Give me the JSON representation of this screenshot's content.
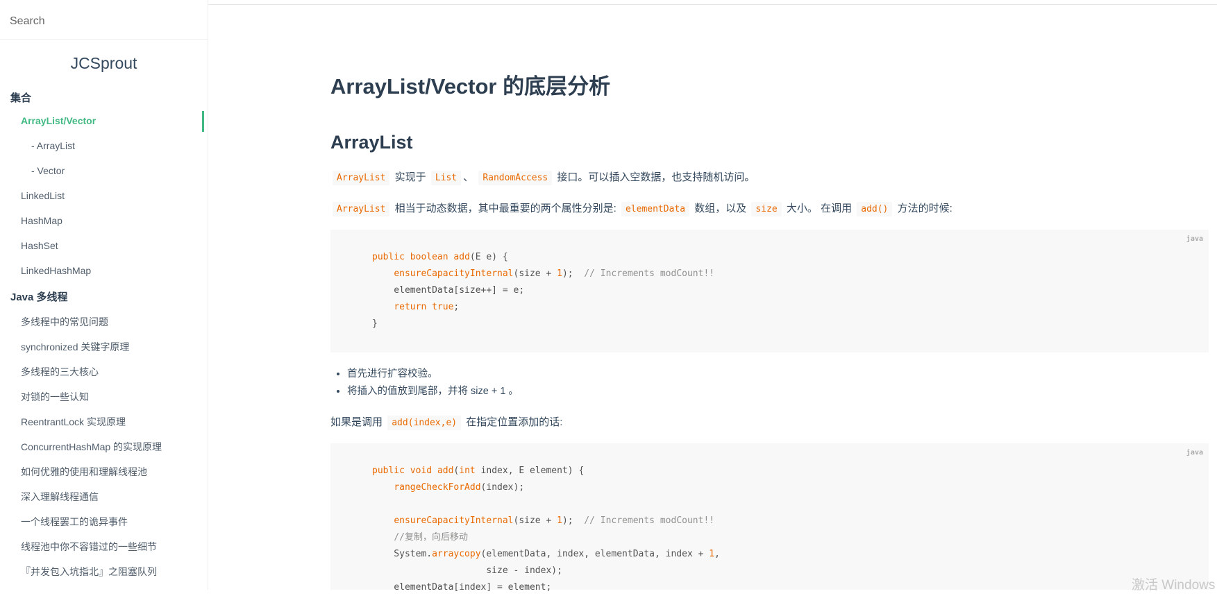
{
  "search": {
    "placeholder": "Search"
  },
  "app_name": "JCSprout",
  "sidebar": {
    "sections": [
      {
        "title": "集合"
      },
      {
        "title": "Java 多线程"
      }
    ],
    "items": [
      {
        "label": "ArrayList/Vector",
        "active": true
      },
      {
        "label": "- ArrayList"
      },
      {
        "label": "- Vector"
      },
      {
        "label": "LinkedList"
      },
      {
        "label": "HashMap"
      },
      {
        "label": "HashSet"
      },
      {
        "label": "LinkedHashMap"
      },
      {
        "label": "多线程中的常见问题"
      },
      {
        "label": "synchronized 关键字原理"
      },
      {
        "label": "多线程的三大核心"
      },
      {
        "label": "对锁的一些认知"
      },
      {
        "label": "ReentrantLock 实现原理"
      },
      {
        "label": "ConcurrentHashMap 的实现原理"
      },
      {
        "label": "如何优雅的使用和理解线程池"
      },
      {
        "label": "深入理解线程通信"
      },
      {
        "label": "一个线程罢工的诡异事件"
      },
      {
        "label": "线程池中你不容错过的一些细节"
      },
      {
        "label": "『并发包入坑指北』之阻塞队列"
      }
    ]
  },
  "content": {
    "title": "ArrayList/Vector 的底层分析",
    "section_title": "ArrayList",
    "p1": {
      "code1": "ArrayList",
      "t1": "实现于",
      "code2": "List",
      "t2": "、",
      "code3": "RandomAccess",
      "t3": "接口。可以插入空数据，也支持随机访问。"
    },
    "p2": {
      "code1": "ArrayList",
      "t1": "相当于动态数据，其中最重要的两个属性分别是:",
      "code2": "elementData",
      "t2": "数组，以及",
      "code3": "size",
      "t3": "大小。 在调用",
      "code4": "add()",
      "t4": "方法的时候:"
    },
    "code_block_1": {
      "lang": "java",
      "lines": [
        "public boolean add(E e) {",
        "    ensureCapacityInternal(size + 1);  // Increments modCount!!",
        "    elementData[size++] = e;",
        "    return true;",
        "}"
      ]
    },
    "bullets": [
      "首先进行扩容校验。",
      "将插入的值放到尾部，并将 size + 1 。"
    ],
    "p3": {
      "t1": "如果是调用",
      "code1": "add(index,e)",
      "t2": "在指定位置添加的话:"
    },
    "code_block_2": {
      "lang": "java",
      "lines": [
        "public void add(int index, E element) {",
        "    rangeCheckForAdd(index);",
        "",
        "    ensureCapacityInternal(size + 1);  // Increments modCount!!",
        "    //复制，向后移动",
        "    System.arraycopy(elementData, index, elementData, index + 1,",
        "                     size - index);",
        "    elementData[index] = element;"
      ]
    }
  },
  "watermark": "激活 Windows"
}
